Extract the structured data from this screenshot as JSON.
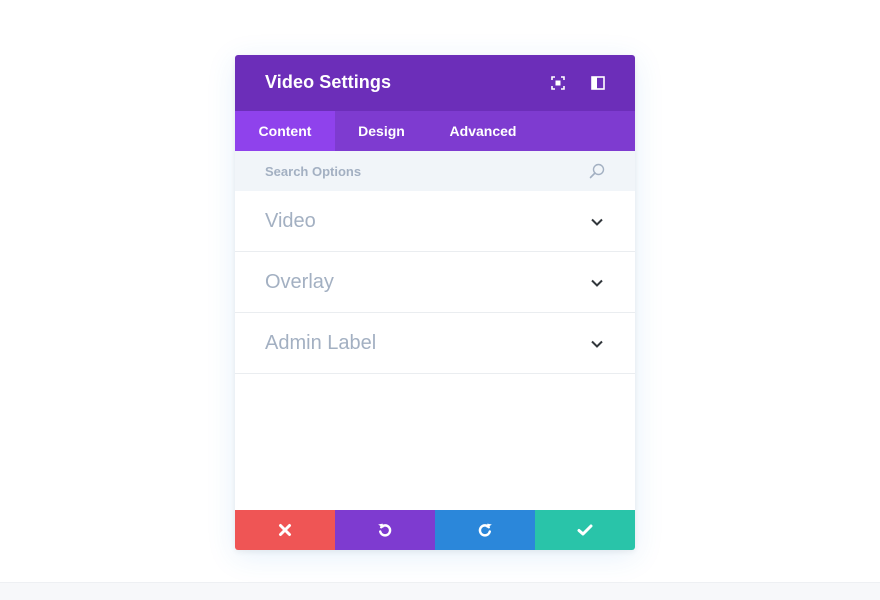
{
  "modal": {
    "title": "Video Settings",
    "header_icons": [
      "expand-icon",
      "sidebar-icon"
    ]
  },
  "tabs": [
    {
      "label": "Content",
      "active": true
    },
    {
      "label": "Design",
      "active": false
    },
    {
      "label": "Advanced",
      "active": false
    }
  ],
  "search": {
    "placeholder": "Search Options",
    "value": ""
  },
  "toggles": [
    {
      "label": "Video"
    },
    {
      "label": "Overlay"
    },
    {
      "label": "Admin Label"
    }
  ],
  "footer": {
    "buttons": [
      {
        "icon": "close-icon",
        "color": "#ef5555"
      },
      {
        "icon": "undo-icon",
        "color": "#7e3bd0"
      },
      {
        "icon": "redo-icon",
        "color": "#2b87da"
      },
      {
        "icon": "check-icon",
        "color": "#29c4a9"
      }
    ]
  },
  "colors": {
    "header": "#6c2eb9",
    "tabs": "#7e3bd0",
    "active_tab": "#8f42ec",
    "search_bg": "#f1f5f9",
    "muted_text": "#a3b0c2"
  }
}
